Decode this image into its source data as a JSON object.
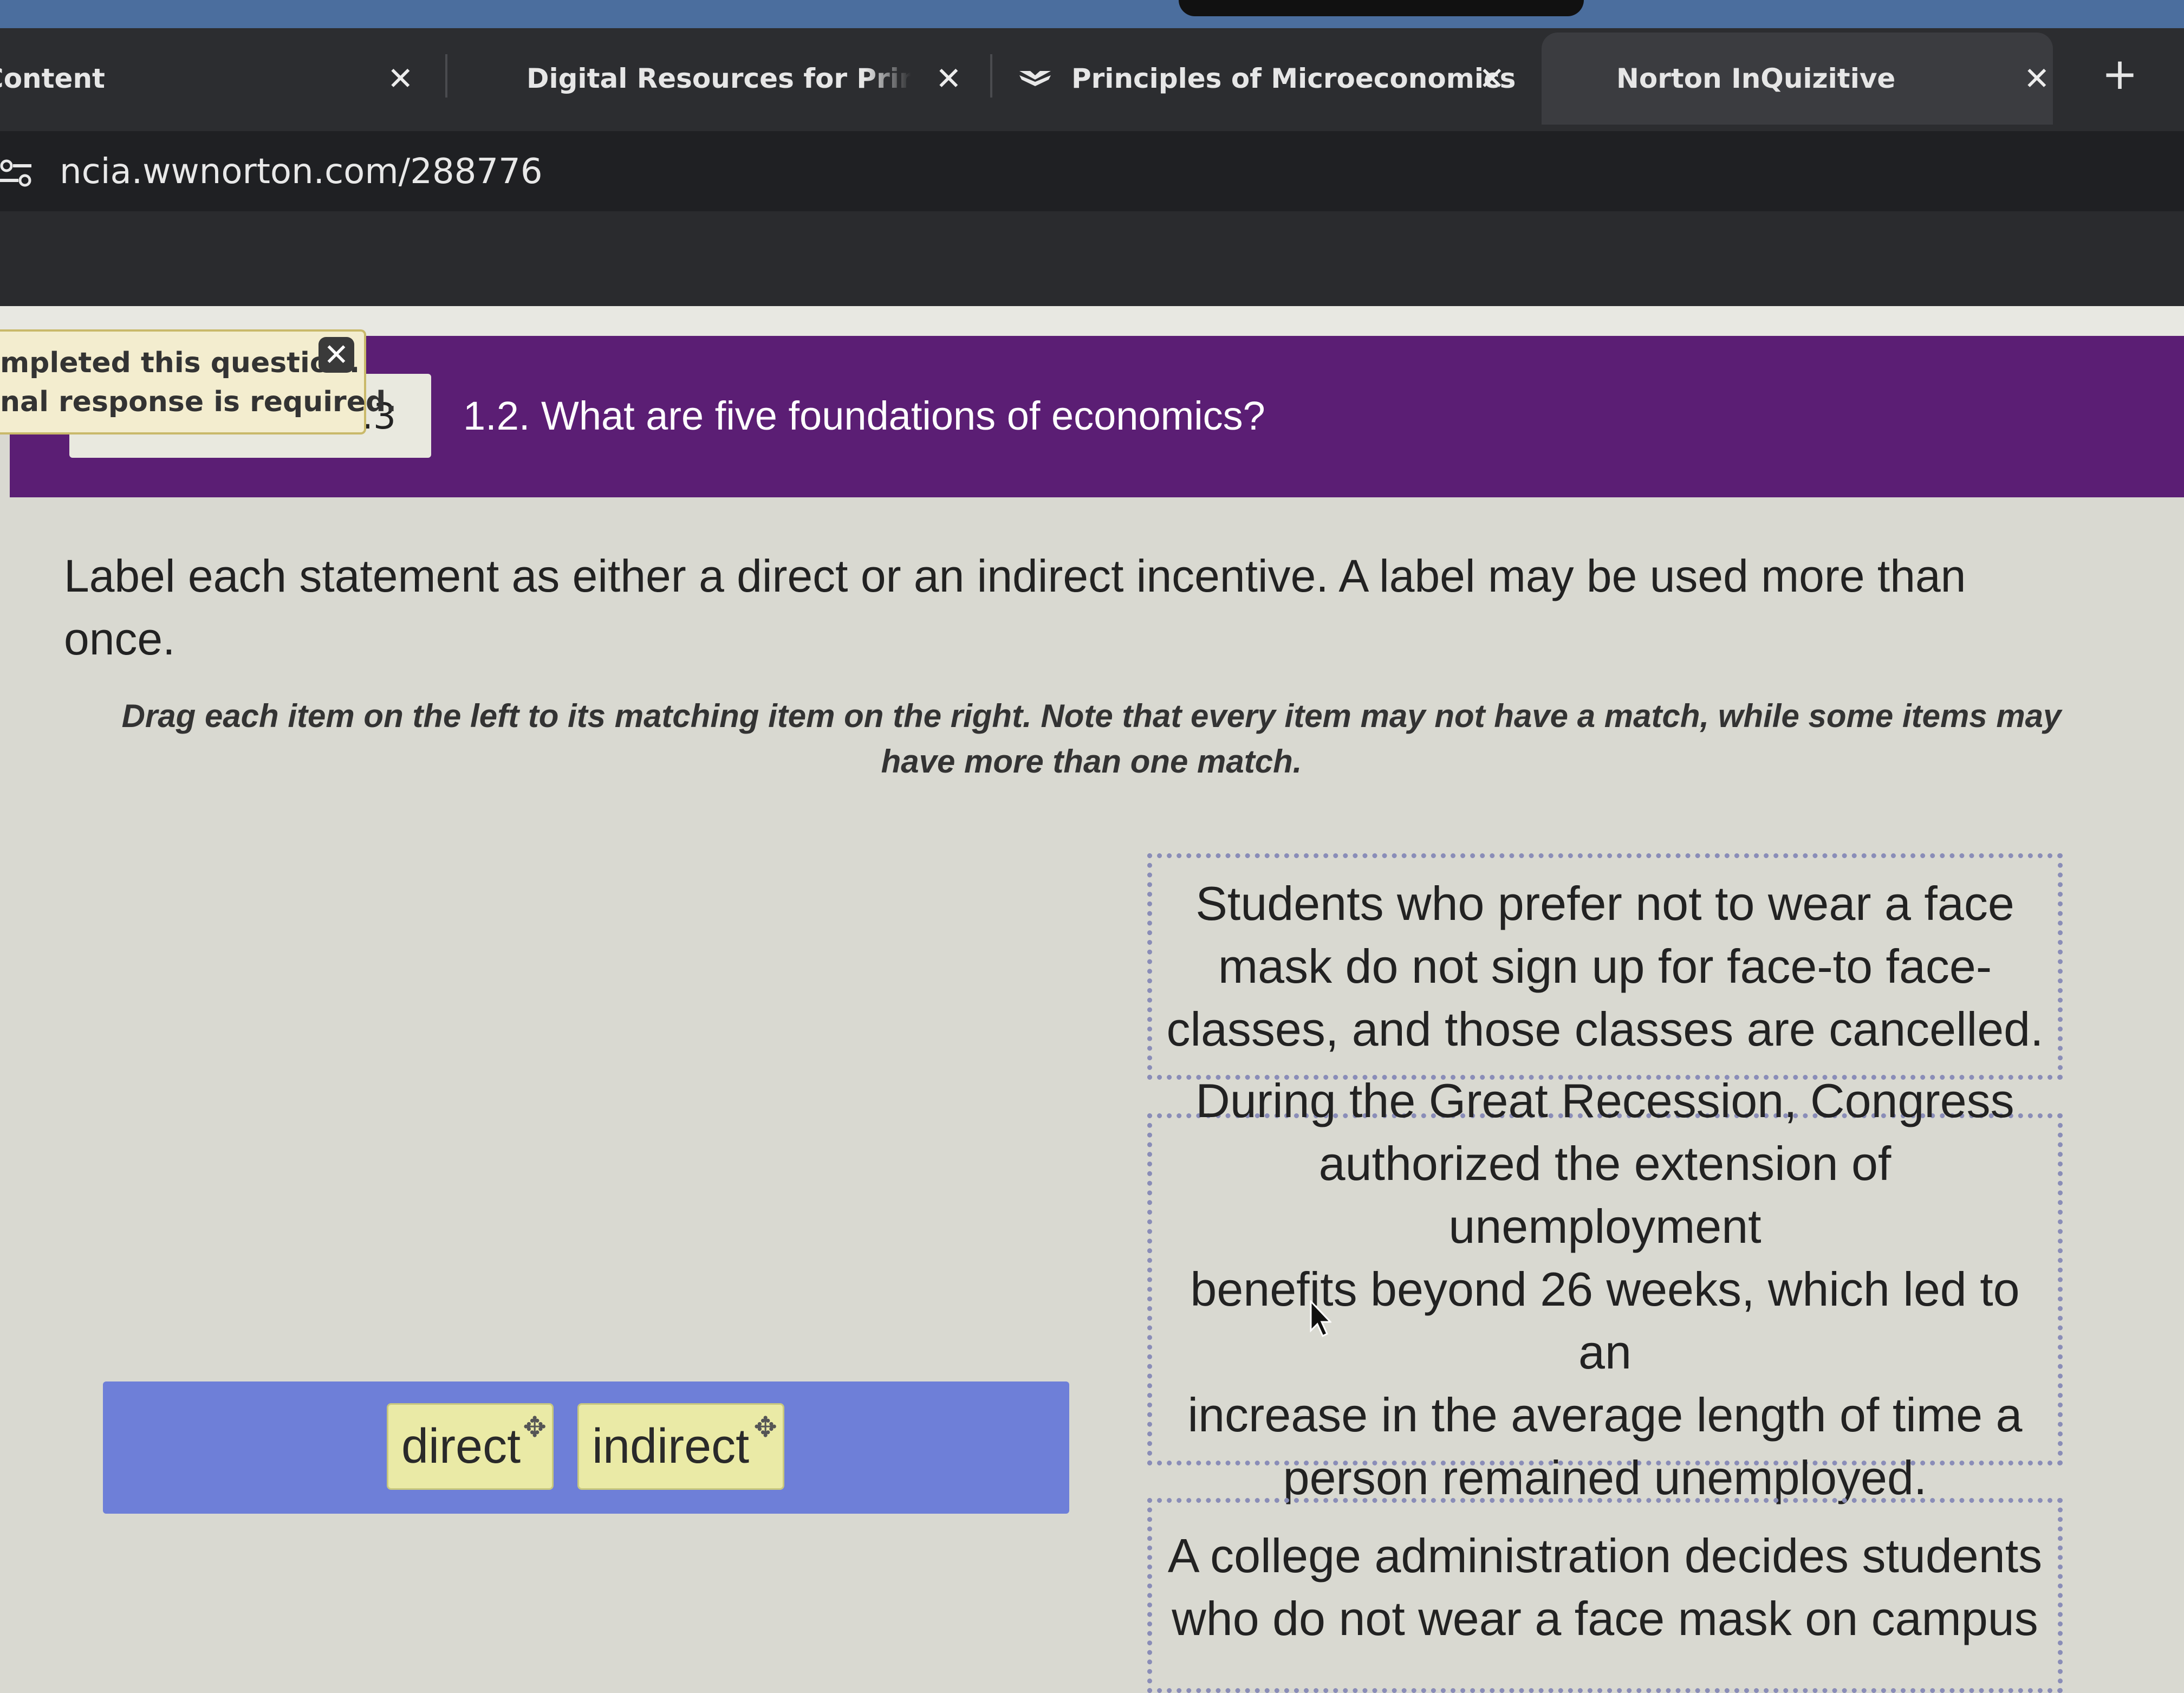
{
  "browser": {
    "tabs": [
      {
        "title": "Content",
        "active": false
      },
      {
        "title": "Digital Resources for Principle",
        "active": false
      },
      {
        "title": "Principles of Microeconomics",
        "active": false
      },
      {
        "title": "Norton InQuizitive",
        "active": true
      }
    ],
    "close_glyph": "✕",
    "new_tab_glyph": "+",
    "url": "ncia.wwnorton.com/288776"
  },
  "header": {
    "question_number": ".3",
    "question_title": "1.2. What are five foundations of economics?"
  },
  "notice": {
    "line1": "mpleted this question.",
    "line2": "nal response is required.",
    "close_glyph": "✕"
  },
  "question": {
    "instruction": "Label each statement as either a direct or an indirect incentive. A label may be used more than once.",
    "drag_note": "Drag each item on the left to its matching item on the right. Note that every item may not have a match, while some items may have more than one match."
  },
  "labels": [
    "direct",
    "indirect"
  ],
  "drag_glyph": "✥",
  "statements": [
    [
      "Students who prefer not to wear a face",
      "mask do not sign up for face-to face-",
      "classes, and those classes are cancelled."
    ],
    [
      "During the Great Recession, Congress",
      "authorized the extension of unemployment",
      "benefits beyond 26 weeks, which led to an",
      "increase in the average length of time a",
      "person remained unemployed."
    ],
    [
      "A college administration decides students",
      "who do not wear a face mask on campus"
    ]
  ],
  "colors": {
    "header_purple": "#5b1e74",
    "tray_blue": "#6e7fd8",
    "chip_yellow": "#eaeaa6",
    "notice_bg": "#f3edcf"
  }
}
